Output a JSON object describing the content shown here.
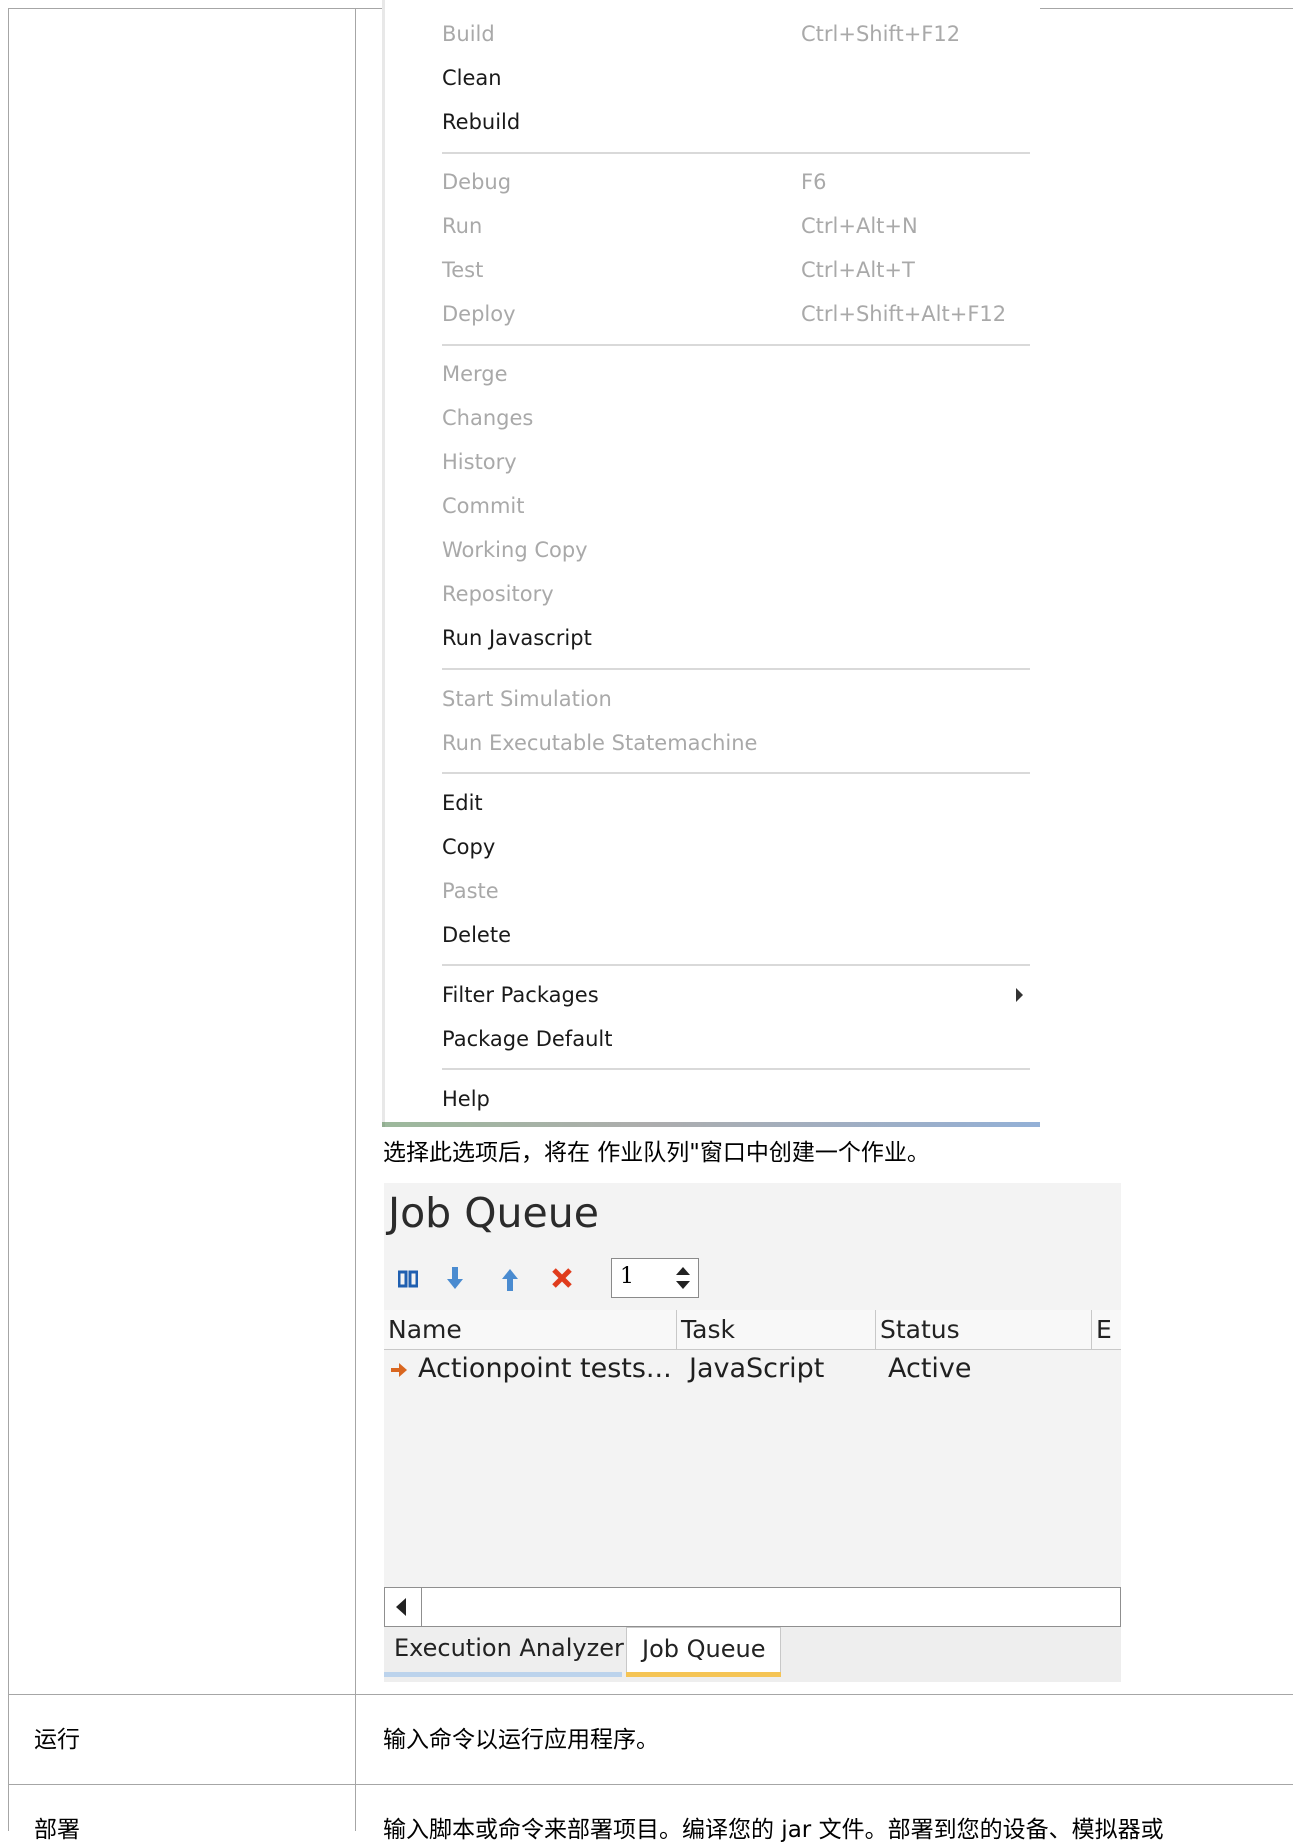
{
  "context_menu": {
    "items": [
      {
        "label": "Build",
        "shortcut": "Ctrl+Shift+F12",
        "enabled": false
      },
      {
        "label": "Clean",
        "shortcut": "",
        "enabled": true
      },
      {
        "label": "Rebuild",
        "shortcut": "",
        "enabled": true
      },
      {
        "label": "Debug",
        "shortcut": "F6",
        "enabled": false
      },
      {
        "label": "Run",
        "shortcut": "Ctrl+Alt+N",
        "enabled": false
      },
      {
        "label": "Test",
        "shortcut": "Ctrl+Alt+T",
        "enabled": false
      },
      {
        "label": "Deploy",
        "shortcut": "Ctrl+Shift+Alt+F12",
        "enabled": false
      },
      {
        "label": "Merge",
        "shortcut": "",
        "enabled": false
      },
      {
        "label": "Changes",
        "shortcut": "",
        "enabled": false
      },
      {
        "label": "History",
        "shortcut": "",
        "enabled": false
      },
      {
        "label": "Commit",
        "shortcut": "",
        "enabled": false
      },
      {
        "label": "Working Copy",
        "shortcut": "",
        "enabled": false
      },
      {
        "label": "Repository",
        "shortcut": "",
        "enabled": false
      },
      {
        "label": "Run Javascript",
        "shortcut": "",
        "enabled": true
      },
      {
        "label": "Start Simulation",
        "shortcut": "",
        "enabled": false
      },
      {
        "label": "Run Executable Statemachine",
        "shortcut": "",
        "enabled": false
      },
      {
        "label": "Edit",
        "shortcut": "",
        "enabled": true
      },
      {
        "label": "Copy",
        "shortcut": "",
        "enabled": true
      },
      {
        "label": "Paste",
        "shortcut": "",
        "enabled": false
      },
      {
        "label": "Delete",
        "shortcut": "",
        "enabled": true
      },
      {
        "label": "Filter Packages",
        "shortcut": "",
        "enabled": true,
        "submenu": true
      },
      {
        "label": "Package Default",
        "shortcut": "",
        "enabled": true
      },
      {
        "label": "Help",
        "shortcut": "",
        "enabled": true
      }
    ]
  },
  "caption": "选择此选项后，将在 作业队列\"窗口中创建一个作业。",
  "job_queue": {
    "title": "Job Queue",
    "toolbar": {
      "pause_icon": "pause-icon",
      "move_down_icon": "arrow-down-icon",
      "move_up_icon": "arrow-up-icon",
      "delete_icon": "delete-x-icon",
      "spinner_value": "1"
    },
    "columns": [
      "Name",
      "Task",
      "Status",
      "E"
    ],
    "rows": [
      {
        "name": "Actionpoint tests...",
        "task": "JavaScript",
        "status": "Active"
      }
    ],
    "tabs": [
      "Execution Analyzer",
      "Job Queue"
    ],
    "active_tab": "Job Queue"
  },
  "table_rows": [
    {
      "term": "运行",
      "description": "输入命令以运行应用程序。"
    },
    {
      "term": "部署",
      "description": "输入脚本或命令来部署项目。编译您的 jar 文件。部署到您的设备、模拟器或"
    }
  ],
  "colors": {
    "border": "#a6a6a6",
    "disabled_text": "#a9a9a9",
    "delete_red": "#e03c1c",
    "arrow_blue": "#4a8bd0",
    "active_tab_underline": "#f5c454",
    "inactive_tab_underline": "#bcd3ec",
    "row_arrow_orange": "#d9661f"
  }
}
